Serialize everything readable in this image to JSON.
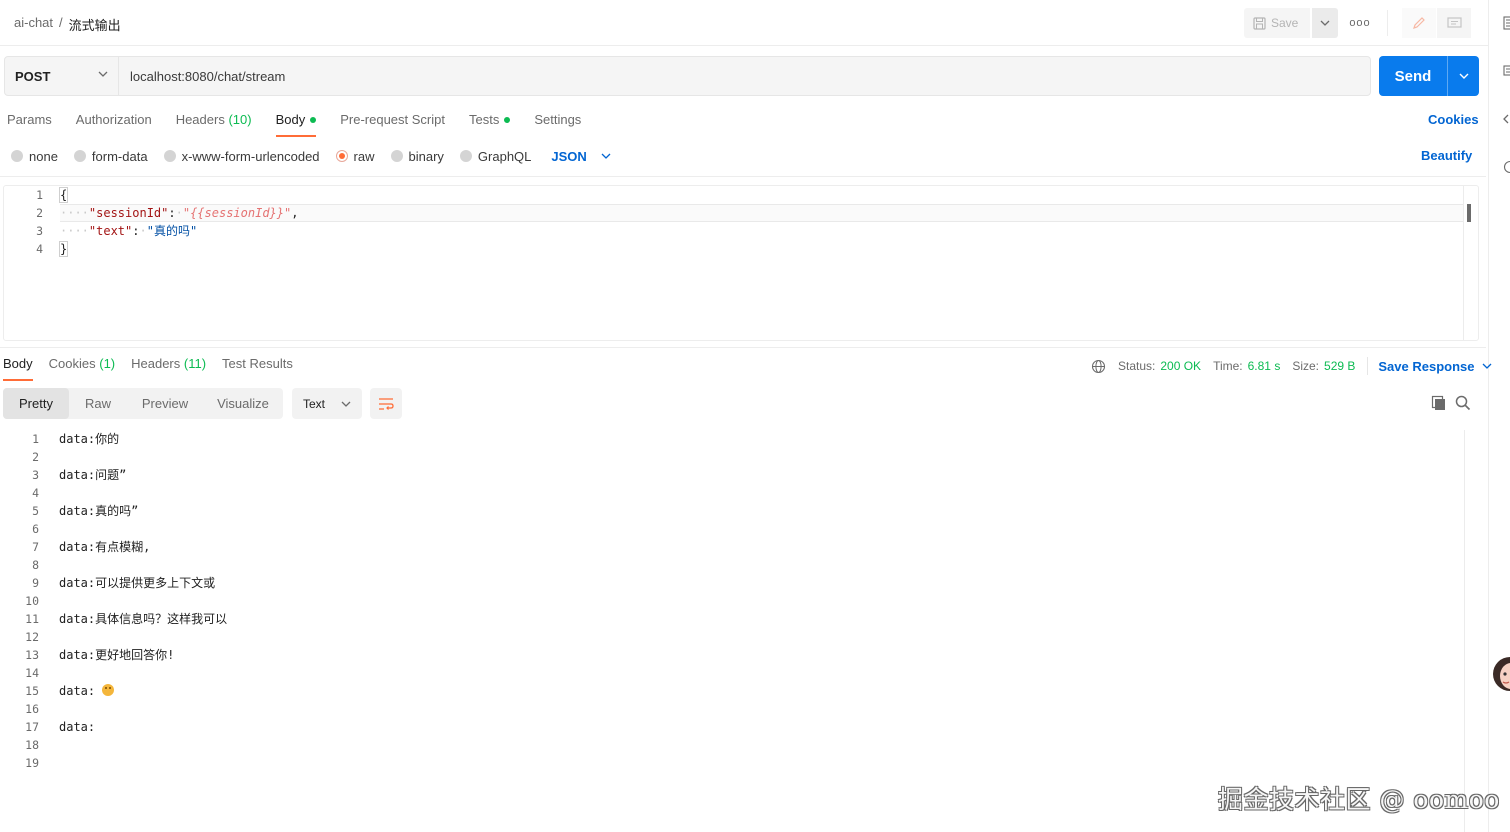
{
  "breadcrumb": {
    "collection": "ai-chat",
    "separator": "/",
    "request": "流式输出"
  },
  "toolbar": {
    "save_label": "Save",
    "more_label": "ooo"
  },
  "request": {
    "method": "POST",
    "url": "localhost:8080/chat/stream",
    "send_label": "Send",
    "tabs": [
      {
        "label": "Params"
      },
      {
        "label": "Authorization"
      },
      {
        "label": "Headers",
        "count": "(10)"
      },
      {
        "label": "Body"
      },
      {
        "label": "Pre-request Script"
      },
      {
        "label": "Tests"
      },
      {
        "label": "Settings"
      }
    ],
    "cookies_label": "Cookies",
    "body_types": [
      "none",
      "form-data",
      "x-www-form-urlencoded",
      "raw",
      "binary",
      "GraphQL"
    ],
    "body_format": "JSON",
    "beautify_label": "Beautify",
    "line_numbers": [
      "1",
      "2",
      "3",
      "4"
    ],
    "body": {
      "open_brace": "{",
      "key1": "\"sessionId\"",
      "val1": "\"{{sessionId}}\"",
      "key2": "\"text\"",
      "val2": "\"真的吗\"",
      "close_brace": "}"
    }
  },
  "response": {
    "tabs": [
      {
        "label": "Body"
      },
      {
        "label": "Cookies",
        "count": "(1)"
      },
      {
        "label": "Headers",
        "count": "(11)"
      },
      {
        "label": "Test Results"
      }
    ],
    "status_label": "Status:",
    "status_value": "200 OK",
    "time_label": "Time:",
    "time_value": "6.81 s",
    "size_label": "Size:",
    "size_value": "529 B",
    "save_response_label": "Save Response",
    "view_tabs": [
      "Pretty",
      "Raw",
      "Preview",
      "Visualize"
    ],
    "format": "Text",
    "line_numbers": [
      "1",
      "2",
      "3",
      "4",
      "5",
      "6",
      "7",
      "8",
      "9",
      "10",
      "11",
      "12",
      "13",
      "14",
      "15",
      "16",
      "17",
      "18",
      "19"
    ],
    "lines": [
      "data:你的",
      "",
      "data:问题”",
      "",
      "data:真的吗”",
      "",
      "data:有点模糊,",
      "",
      "data:可以提供更多上下文或",
      "",
      "data:具体信息吗？这样我可以",
      "",
      "data:更好地回答你!",
      "",
      "data: ",
      "",
      "data:",
      "",
      ""
    ]
  },
  "watermark": "掘金技术社区 @ oomoo",
  "colors": {
    "accent": "#ff6c37",
    "primary": "#097bed",
    "link": "#0265d2",
    "success": "#0cbb52"
  }
}
